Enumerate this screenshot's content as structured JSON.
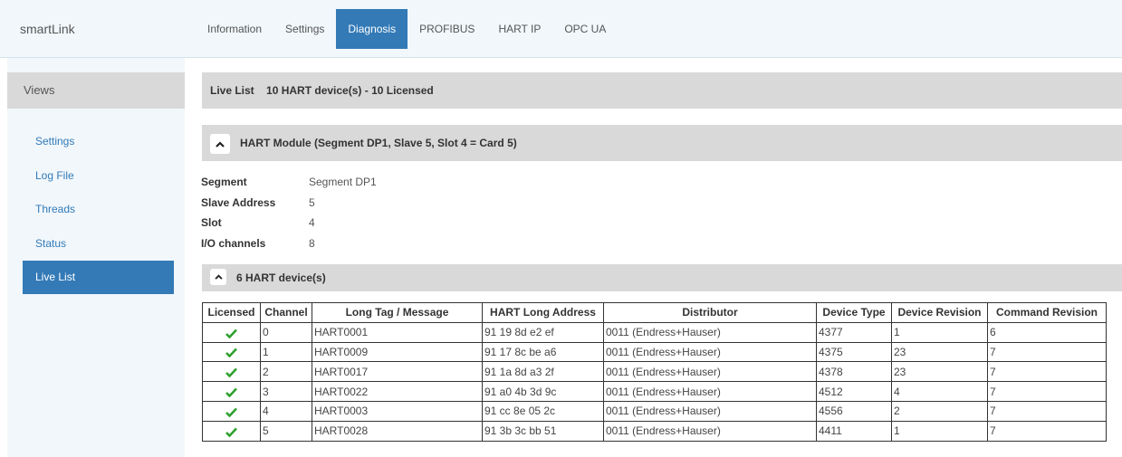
{
  "app": {
    "brand": "smartLink"
  },
  "topnav": {
    "tabs": [
      {
        "label": "Information",
        "active": false
      },
      {
        "label": "Settings",
        "active": false
      },
      {
        "label": "Diagnosis",
        "active": true
      },
      {
        "label": "PROFIBUS",
        "active": false
      },
      {
        "label": "HART IP",
        "active": false
      },
      {
        "label": "OPC UA",
        "active": false
      }
    ]
  },
  "sidebar": {
    "header": "Views",
    "items": [
      {
        "label": "Settings",
        "active": false
      },
      {
        "label": "Log File",
        "active": false
      },
      {
        "label": "Threads",
        "active": false
      },
      {
        "label": "Status",
        "active": false
      },
      {
        "label": "Live List",
        "active": true
      }
    ]
  },
  "live_list": {
    "label": "Live List",
    "summary": "10 HART device(s) - 10 Licensed"
  },
  "module": {
    "title": "HART Module (Segment DP1, Slave 5, Slot 4 = Card 5)",
    "props": [
      {
        "key": "Segment",
        "value": "Segment DP1"
      },
      {
        "key": "Slave Address",
        "value": "5"
      },
      {
        "key": "Slot",
        "value": "4"
      },
      {
        "key": "I/O channels",
        "value": "8"
      }
    ]
  },
  "devices": {
    "title": "6 HART device(s)",
    "columns": [
      "Licensed",
      "Channel",
      "Long Tag / Message",
      "HART Long Address",
      "Distributor",
      "Device Type",
      "Device Revision",
      "Command Revision"
    ],
    "rows": [
      {
        "licensed": true,
        "channel": "0",
        "tag": "HART0001",
        "address": "91 19 8d e2 ef",
        "distributor": "0011 (Endress+Hauser)",
        "device_type": "4377",
        "device_revision": "1",
        "command_revision": "6"
      },
      {
        "licensed": true,
        "channel": "1",
        "tag": "HART0009",
        "address": "91 17 8c be a6",
        "distributor": "0011 (Endress+Hauser)",
        "device_type": "4375",
        "device_revision": "23",
        "command_revision": "7"
      },
      {
        "licensed": true,
        "channel": "2",
        "tag": "HART0017",
        "address": "91 1a 8d a3 2f",
        "distributor": "0011 (Endress+Hauser)",
        "device_type": "4378",
        "device_revision": "23",
        "command_revision": "7"
      },
      {
        "licensed": true,
        "channel": "3",
        "tag": "HART0022",
        "address": "91 a0 4b 3d 9c",
        "distributor": "0011 (Endress+Hauser)",
        "device_type": "4512",
        "device_revision": "4",
        "command_revision": "7"
      },
      {
        "licensed": true,
        "channel": "4",
        "tag": "HART0003",
        "address": "91 cc 8e 05 2c",
        "distributor": "0011 (Endress+Hauser)",
        "device_type": "4556",
        "device_revision": "2",
        "command_revision": "7"
      },
      {
        "licensed": true,
        "channel": "5",
        "tag": "HART0028",
        "address": "91 3b 3c bb 51",
        "distributor": "0011 (Endress+Hauser)",
        "device_type": "4411",
        "device_revision": "1",
        "command_revision": "7"
      }
    ]
  },
  "colors": {
    "accent": "#337ab7",
    "check": "#2ea02e",
    "header_bg": "#d9d9d9",
    "nav_bg": "#f1f7fb"
  },
  "icons": {
    "collapse": "chevron-up-icon",
    "licensed": "checkmark-icon"
  }
}
